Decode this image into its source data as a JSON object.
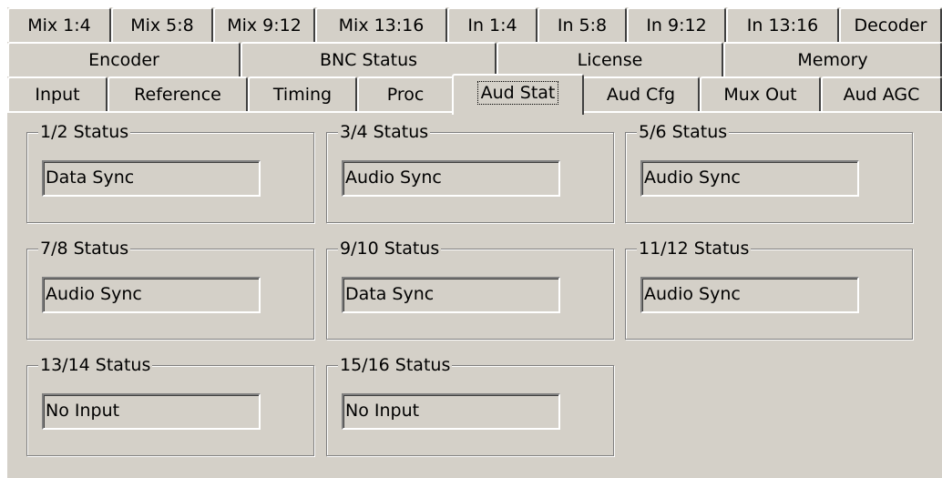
{
  "tabs": {
    "row1": [
      "Mix 1:4",
      "Mix 5:8",
      "Mix 9:12",
      "Mix 13:16",
      "In 1:4",
      "In 5:8",
      "In 9:12",
      "In 13:16",
      "Decoder"
    ],
    "row2": [
      "Encoder",
      "BNC Status",
      "License",
      "Memory"
    ],
    "row3": [
      "Input",
      "Reference",
      "Timing",
      "Proc",
      "Aud Stat",
      "Aud Cfg",
      "Mux Out",
      "Aud AGC"
    ],
    "selected": "Aud Stat"
  },
  "groups": [
    {
      "label": "1/2 Status",
      "value": "Data Sync"
    },
    {
      "label": "3/4 Status",
      "value": "Audio Sync"
    },
    {
      "label": "5/6 Status",
      "value": "Audio Sync"
    },
    {
      "label": "7/8 Status",
      "value": "Audio Sync"
    },
    {
      "label": "9/10 Status",
      "value": "Data Sync"
    },
    {
      "label": "11/12 Status",
      "value": "Audio Sync"
    },
    {
      "label": "13/14 Status",
      "value": "No Input"
    },
    {
      "label": "15/16 Status",
      "value": "No Input"
    }
  ]
}
